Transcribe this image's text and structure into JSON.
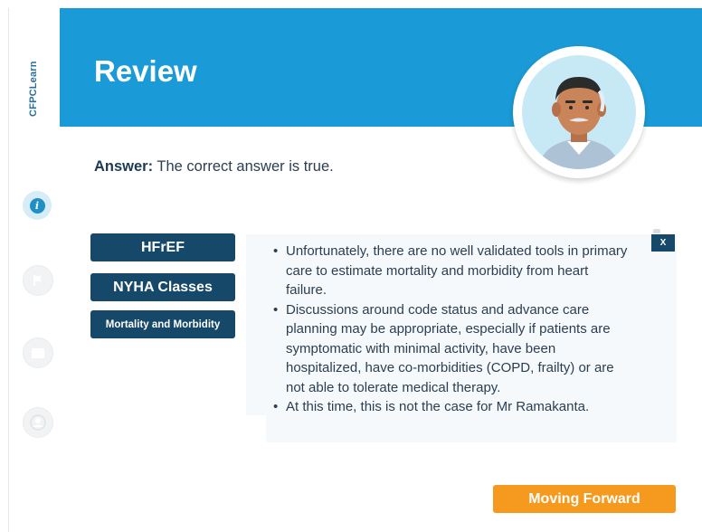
{
  "brand": {
    "name": "CFPCLearn"
  },
  "header": {
    "title": "Review"
  },
  "answer": {
    "label": "Answer:",
    "text": "The correct answer is true."
  },
  "tabs": [
    {
      "label": "HFrEF"
    },
    {
      "label": "NYHA Classes"
    },
    {
      "label": "Mortality and Morbidity"
    }
  ],
  "panel": {
    "close_label": "X",
    "bullets": [
      "Unfortunately, there are no well validated tools in primary care to estimate mortality and morbidity from heart failure.",
      "Discussions around code status and advance care planning may be appropriate, especially if patients are symptomatic with minimal activity, have been hospitalized, have co-morbidities (COPD, frailty) or are not able to tolerate medical therapy.",
      "At this time, this is not the case for Mr Ramakanta."
    ]
  },
  "footer": {
    "next_label": "Moving Forward"
  },
  "sidebar": {
    "items": [
      {
        "icon": "info-icon",
        "active": true
      },
      {
        "icon": "flag-icon",
        "active": false
      },
      {
        "icon": "window-icon",
        "active": false
      },
      {
        "icon": "user-icon",
        "active": false
      }
    ]
  },
  "colors": {
    "header": "#1a9ad6",
    "tab": "#154869",
    "accent": "#f59a1e",
    "panel": "#f5f9fb"
  }
}
